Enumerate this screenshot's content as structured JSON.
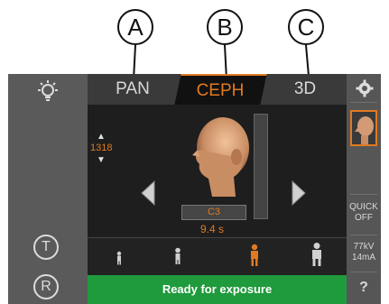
{
  "callouts": [
    "A",
    "B",
    "C"
  ],
  "tabs": [
    "PAN",
    "CEPH",
    "3D"
  ],
  "height_value": "1318",
  "region_label": "C3",
  "exposure_time": "9.4 s",
  "status": "Ready for exposure",
  "right_panel": {
    "quick_line1": "QUICK",
    "quick_line2": "OFF",
    "kv": "77kV",
    "ma": "14mA",
    "help": "?"
  },
  "left_panel": {
    "t_label": "T",
    "r_label": "R"
  },
  "colors": {
    "accent": "#e07a22",
    "status_green": "#1f9a3c"
  },
  "icons": [
    "lightbulb-icon",
    "settings-gear-icon",
    "head-thumbnail-icon",
    "patient-size-icons"
  ]
}
